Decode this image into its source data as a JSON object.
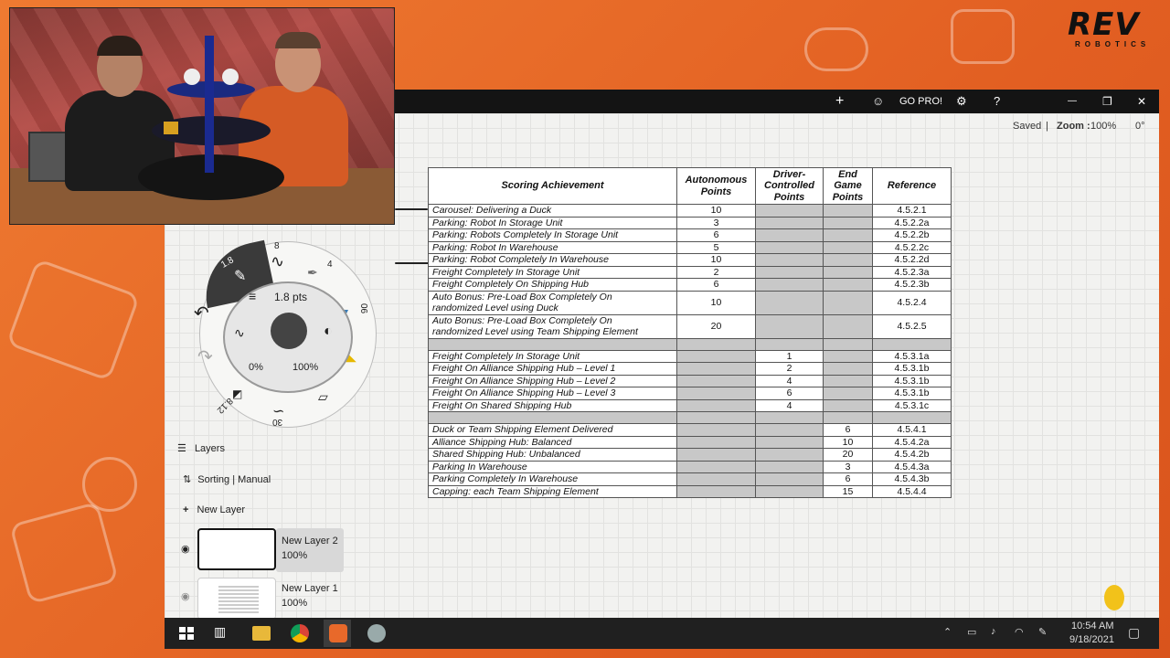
{
  "brand": {
    "logo_text": "REV",
    "logo_sub": "ROBOTICS"
  },
  "app": {
    "toolbar": {
      "plus": "+",
      "user": "☺",
      "gopro": "GO PRO!",
      "settings": "⚙",
      "help": "?",
      "minimize": "—",
      "restore": "❐",
      "close": "✕"
    },
    "status": {
      "saved": "Saved",
      "separator": "|",
      "zoom_label": "Zoom :",
      "zoom_value": "100%",
      "angle": "0°"
    }
  },
  "table": {
    "headers": {
      "achievement": "Scoring Achievement",
      "auto": "Autonomous Points",
      "driver": "Driver-Controlled Points",
      "endgame": "End Game Points",
      "reference": "Reference"
    },
    "auto_rows": [
      {
        "desc": "Carousel: Delivering a Duck",
        "auto": "10",
        "ref": "4.5.2.1"
      },
      {
        "desc": "Parking: Robot In Storage Unit",
        "auto": "3",
        "ref": "4.5.2.2a"
      },
      {
        "desc": "Parking: Robots Completely In Storage Unit",
        "auto": "6",
        "ref": "4.5.2.2b"
      },
      {
        "desc": "Parking: Robot In Warehouse",
        "auto": "5",
        "ref": "4.5.2.2c"
      },
      {
        "desc": "Parking: Robot Completely In Warehouse",
        "auto": "10",
        "ref": "4.5.2.2d"
      },
      {
        "desc": "Freight Completely In Storage Unit",
        "auto": "2",
        "ref": "4.5.2.3a"
      },
      {
        "desc": "Freight Completely On Shipping Hub",
        "auto": "6",
        "ref": "4.5.2.3b"
      }
    ],
    "bonus_rows": [
      {
        "prefix": "Auto Bonus: ",
        "line1": "Pre-Load Box Completely On",
        "line2_italic1": "randomized ",
        "line2_plain": "Level",
        "line2_rest": " using ",
        "line2_italic2": "Duck",
        "auto": "10",
        "ref": "4.5.2.4"
      },
      {
        "prefix": "Auto Bonus: ",
        "line1": "Pre-Load Box Completely On",
        "line2_italic1": "randomized ",
        "line2_plain": "Level",
        "line2_rest": " using ",
        "line2_italic2": "Team Shipping Element",
        "auto": "20",
        "ref": "4.5.2.5"
      }
    ],
    "driver_rows": [
      {
        "desc": "Freight Completely In Storage Unit",
        "driver": "1",
        "ref": "4.5.3.1a"
      },
      {
        "desc": "Freight On Alliance Shipping Hub – Level 1",
        "driver": "2",
        "ref": "4.5.3.1b"
      },
      {
        "desc": "Freight On Alliance Shipping Hub – Level 2",
        "driver": "4",
        "ref": "4.5.3.1b"
      },
      {
        "desc": "Freight On Alliance Shipping Hub – Level 3",
        "driver": "6",
        "ref": "4.5.3.1b"
      },
      {
        "desc": "Freight On Shared Shipping Hub",
        "driver": "4",
        "ref": "4.5.3.1c"
      }
    ],
    "endgame_rows": [
      {
        "desc": "Duck or Team Shipping Element Delivered",
        "end": "6",
        "ref": "4.5.4.1"
      },
      {
        "desc": "Alliance Shipping Hub: Balanced",
        "end": "10",
        "ref": "4.5.4.2a"
      },
      {
        "desc": "Shared Shipping Hub: Unbalanced",
        "end": "20",
        "ref": "4.5.4.2b"
      },
      {
        "desc": "Parking In Warehouse",
        "end": "3",
        "ref": "4.5.4.3a"
      },
      {
        "desc": "Parking Completely In Warehouse",
        "end": "6",
        "ref": "4.5.4.3b"
      },
      {
        "desc": "Capping: each Team Shipping Element",
        "end": "15",
        "ref": "4.5.4.4"
      }
    ]
  },
  "radial": {
    "size_value": "1.8",
    "size_label": "1.8 pts",
    "top": "8",
    "right_top": "4",
    "right": "06",
    "bottom": "30",
    "bottom_left": "8.12",
    "opacity_left": "0%",
    "opacity_right": "100%"
  },
  "layers": {
    "title": "Layers",
    "sorting": "Sorting",
    "sorting_sep": "|",
    "sorting_mode": "Manual",
    "new_layer": "New Layer",
    "items": [
      {
        "name": "New Layer 2",
        "opacity": "100%"
      },
      {
        "name": "New Layer 1",
        "opacity": "100%"
      }
    ]
  },
  "taskbar": {
    "time": "10:54 AM",
    "date": "9/18/2021"
  }
}
